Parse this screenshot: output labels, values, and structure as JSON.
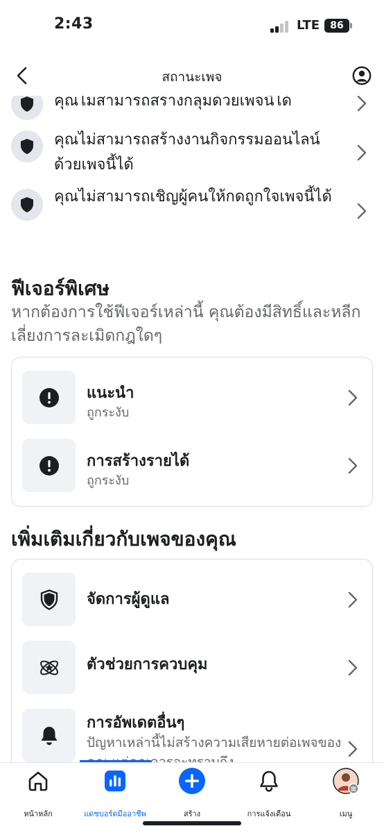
{
  "status_bar": {
    "time": "2:43",
    "network": "LTE",
    "battery": "86"
  },
  "header": {
    "title": "สถานะเพจ"
  },
  "restrictions": [
    {
      "text": "คุณไม่สามารถสร้างกลุ่มด้วยเพจนี้ได้"
    },
    {
      "text": "คุณไม่สามารถสร้างงานกิจกรรมออนไลน์ด้วยเพจนี้ได้"
    },
    {
      "text": "คุณไม่สามารถเชิญผู้คนให้กดถูกใจเพจนี้ได้"
    }
  ],
  "special_features": {
    "title": "ฟีเจอร์พิเศษ",
    "subtitle": "หากต้องการใช้ฟีเจอร์เหล่านี้ คุณต้องมีสิทธิ์และหลีกเลี่ยงการละเมิดกฎใดๆ",
    "items": [
      {
        "title": "แนะนำ",
        "status": "ถูกระงับ",
        "icon": "exclamation-icon"
      },
      {
        "title": "การสร้างรายได้",
        "status": "ถูกระงับ",
        "icon": "exclamation-icon"
      }
    ]
  },
  "more_section": {
    "title": "เพิ่มเติมเกี่ยวกับเพจของคุณ",
    "items": [
      {
        "title": "จัดการผู้ดูแล",
        "icon": "shield-icon"
      },
      {
        "title": "ตัวช่วยการควบคุม",
        "icon": "atom-star-icon"
      },
      {
        "title": "การอัพเดตอื่นๆ",
        "subtitle": "ปัญหาเหล่านี้ไม่สร้างความเสียหายต่อเพจของคุณ แต่คุณควรจะทราบถึง",
        "icon": "bell-icon"
      }
    ]
  },
  "bottom_nav": {
    "items": [
      {
        "label": "หน้าหลัก",
        "icon": "home-icon"
      },
      {
        "label": "แดชบอร์ดมืออาชีพ",
        "icon": "dashboard-icon",
        "active": true
      },
      {
        "label": "สร้าง",
        "icon": "plus-icon"
      },
      {
        "label": "การแจ้งเตือน",
        "icon": "bell-icon"
      },
      {
        "label": "เมนู",
        "icon": "avatar-icon"
      }
    ]
  },
  "colors": {
    "accent": "#0866ff",
    "text": "#1c1e21",
    "muted": "#65676b",
    "icon_bg": "#f0f2f5"
  }
}
